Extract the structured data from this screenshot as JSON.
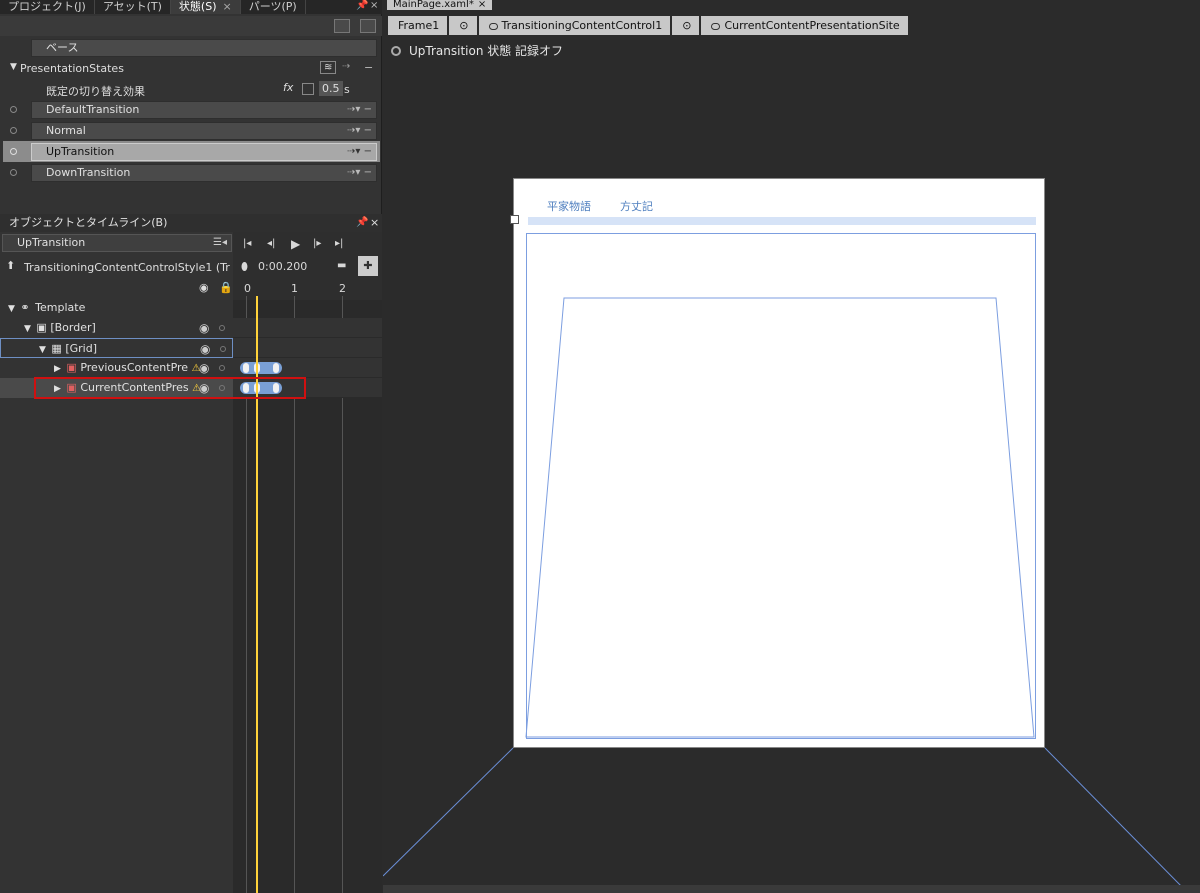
{
  "left_tabs": [
    {
      "label": "プロジェクト(J)",
      "active": false
    },
    {
      "label": "アセット(T)",
      "active": false
    },
    {
      "label": "状態(S)",
      "active": true
    },
    {
      "label": "パーツ(P)",
      "active": false
    }
  ],
  "states": {
    "base_label": "ベース",
    "group_name": "PresentationStates",
    "default_transition_label": "既定の切り替え効果",
    "default_transition_value": "0.5",
    "default_transition_unit": "s",
    "items": [
      {
        "label": "DefaultTransition",
        "selected": false
      },
      {
        "label": "Normal",
        "selected": false
      },
      {
        "label": "UpTransition",
        "selected": true
      },
      {
        "label": "DownTransition",
        "selected": false
      }
    ]
  },
  "objects_panel": {
    "title": "オブジェクトとタイムライン(B)",
    "search_value": "UpTransition",
    "style_label": "TransitioningContentControlStyle1 (Tr…",
    "time": "0:00.200",
    "ruler": [
      "0",
      "1",
      "2"
    ],
    "tree": [
      {
        "label": "Template"
      },
      {
        "label": "[Border]"
      },
      {
        "label": "[Grid]"
      },
      {
        "label": "PreviousContentPre"
      },
      {
        "label": "CurrentContentPres"
      }
    ]
  },
  "document": {
    "tab_label": "MainPage.xaml*",
    "breadcrumbs": [
      "Frame1",
      "TransitioningContentControl1",
      "CurrentContentPresentationSite"
    ],
    "state_message": "UpTransition 状態 記録オフ",
    "canvas_links": [
      "平家物語",
      "方丈記"
    ]
  },
  "colors": {
    "accent_blue": "#7c9ee0",
    "highlight_red": "#d01010",
    "playhead": "#ffd23a"
  }
}
